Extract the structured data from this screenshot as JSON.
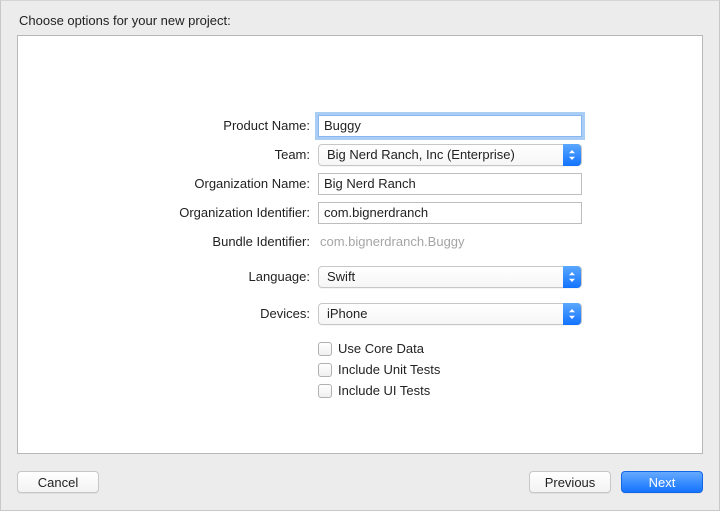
{
  "header": {
    "title": "Choose options for your new project:"
  },
  "form": {
    "productName": {
      "label": "Product Name:",
      "value": "Buggy"
    },
    "team": {
      "label": "Team:",
      "value": "Big Nerd Ranch, Inc (Enterprise)"
    },
    "orgName": {
      "label": "Organization Name:",
      "value": "Big Nerd Ranch"
    },
    "orgId": {
      "label": "Organization Identifier:",
      "value": "com.bignerdranch"
    },
    "bundleId": {
      "label": "Bundle Identifier:",
      "value": "com.bignerdranch.Buggy"
    },
    "language": {
      "label": "Language:",
      "value": "Swift"
    },
    "devices": {
      "label": "Devices:",
      "value": "iPhone"
    },
    "coreData": {
      "label": "Use Core Data",
      "checked": false
    },
    "unitTests": {
      "label": "Include Unit Tests",
      "checked": false
    },
    "uiTests": {
      "label": "Include UI Tests",
      "checked": false
    }
  },
  "footer": {
    "cancel": "Cancel",
    "previous": "Previous",
    "next": "Next"
  }
}
